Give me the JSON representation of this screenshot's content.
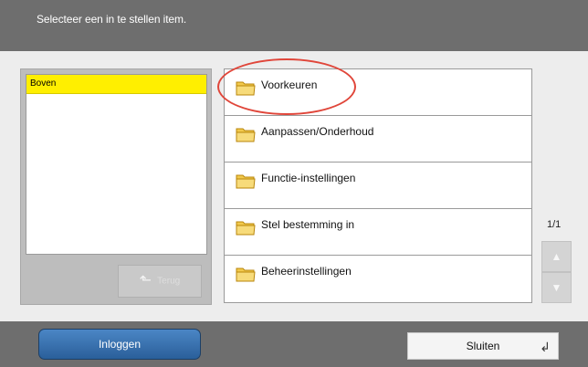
{
  "header": {
    "title": "Selecteer een in te stellen item."
  },
  "left_panel": {
    "selected_item": "Boven",
    "back_label": "Terug"
  },
  "items": [
    {
      "label": "Voorkeuren",
      "icon": "folder-icon"
    },
    {
      "label": "Aanpassen/Onderhoud",
      "icon": "folder-icon"
    },
    {
      "label": "Functie-instellingen",
      "icon": "folder-icon"
    },
    {
      "label": "Stel bestemming in",
      "icon": "folder-icon"
    },
    {
      "label": "Beheerinstellingen",
      "icon": "folder-icon"
    }
  ],
  "pager": {
    "text": "1/1"
  },
  "footer": {
    "login_label": "Inloggen",
    "close_label": "Sluiten"
  },
  "colors": {
    "header_bg": "#6e6e6e",
    "selected_bg": "#ffef00",
    "login_blue": "#2a5f9a",
    "highlight_red": "#e0463a"
  }
}
